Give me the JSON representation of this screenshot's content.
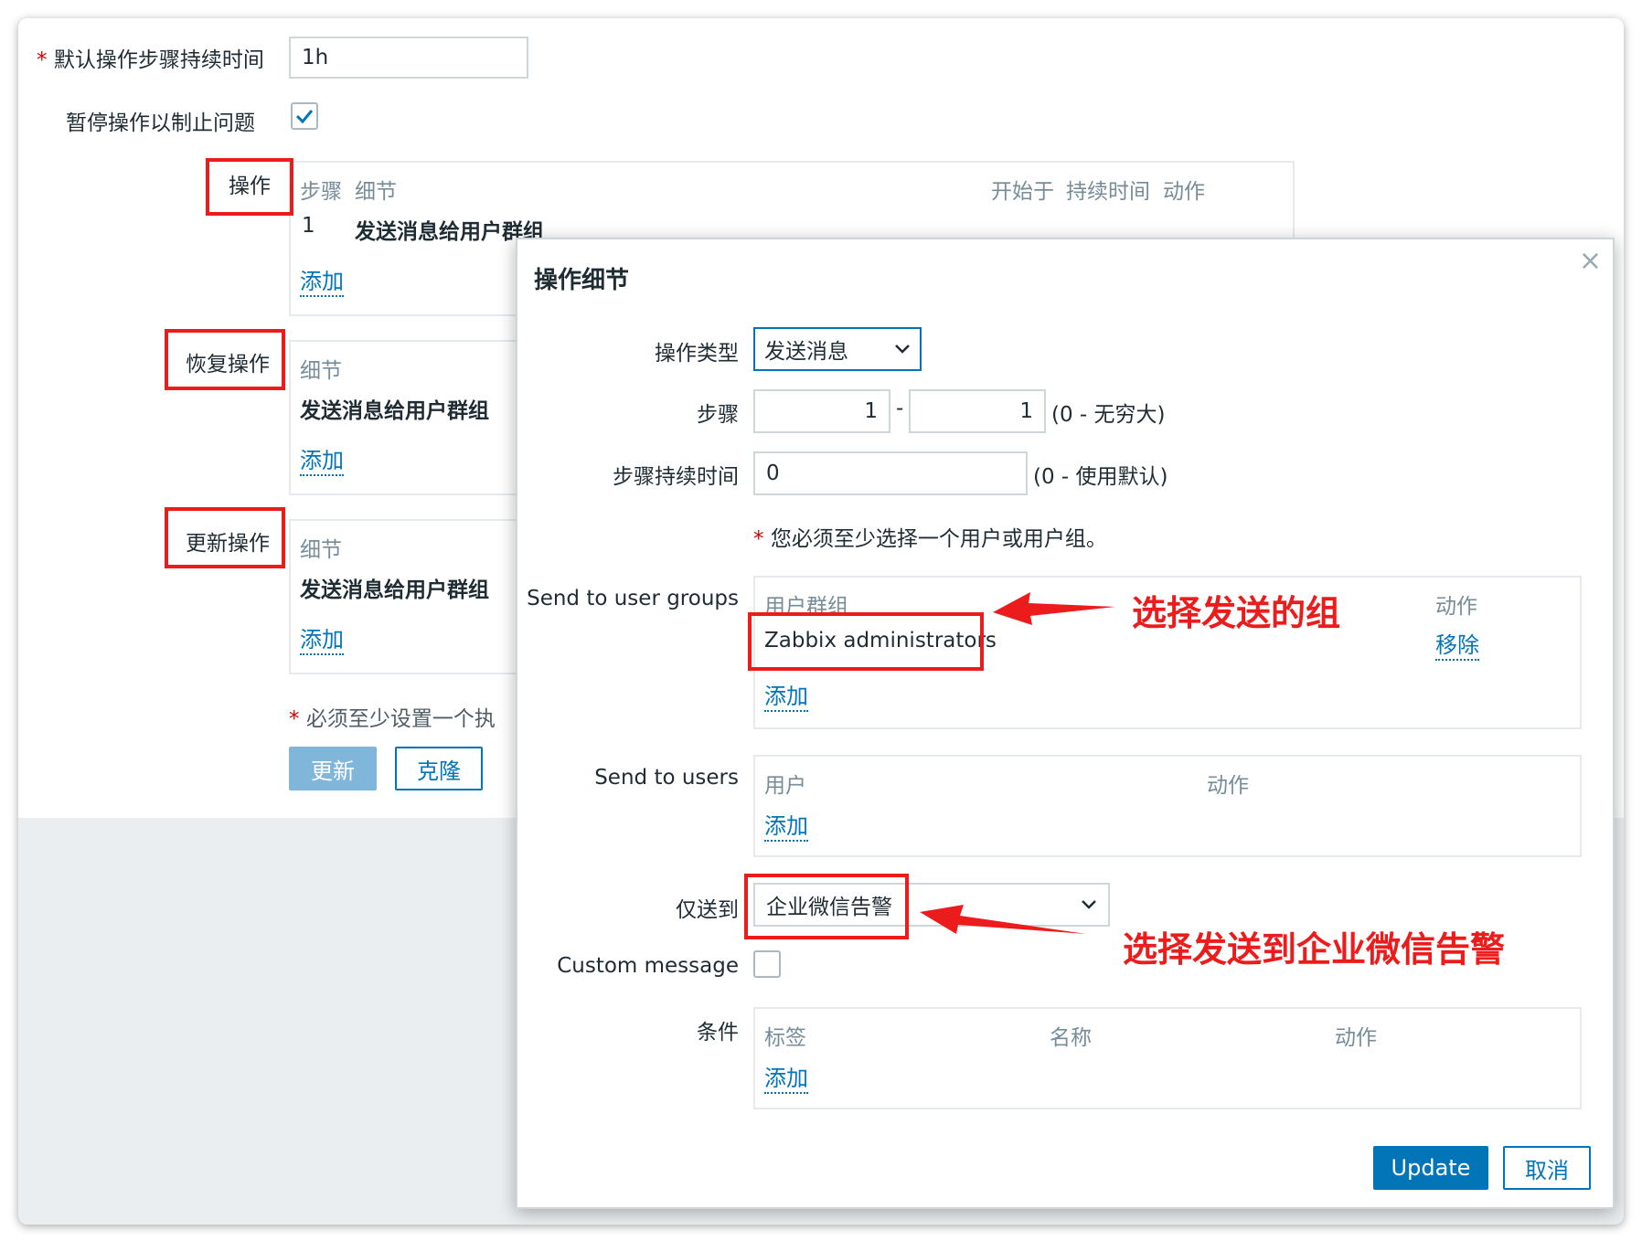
{
  "form": {
    "default_duration_label": "默认操作步骤持续时间",
    "default_duration_value": "1h",
    "pause_label": "暂停操作以制止问题",
    "operations": {
      "label": "操作",
      "col_steps": "步骤",
      "col_details": "细节",
      "col_start": "开始于",
      "col_duration": "持续时间",
      "col_action": "动作",
      "row_step": "1",
      "row_detail": "发送消息给用户群组",
      "add": "添加"
    },
    "recovery": {
      "label": "恢复操作",
      "col_details": "细节",
      "row_detail": "发送消息给用户群组",
      "add": "添加"
    },
    "update_ops": {
      "label": "更新操作",
      "col_details": "细节",
      "row_detail": "发送消息给用户群组",
      "add": "添加"
    },
    "required_note": "必须至少设置一个执",
    "update_button": "更新",
    "clone_button": "克隆"
  },
  "modal": {
    "title": "操作细节",
    "close_glyph": "×",
    "op_type_label": "操作类型",
    "op_type_value": "发送消息",
    "steps_label": "步骤",
    "step_from": "1",
    "step_sep": "-",
    "step_to": "1",
    "steps_hint": "(0 - 无穷大)",
    "step_duration_label": "步骤持续时间",
    "step_duration_value": "0",
    "step_duration_hint": "(0 - 使用默认)",
    "required_msg": "您必须至少选择一个用户或用户组。",
    "groups_label": "Send to user groups",
    "groups_col_group": "用户群组",
    "groups_col_action": "动作",
    "group_name": "Zabbix administrators",
    "group_remove": "移除",
    "groups_add": "添加",
    "users_label": "Send to users",
    "users_col_user": "用户",
    "users_col_action": "动作",
    "users_add": "添加",
    "send_only_label": "仅送到",
    "send_only_value": "企业微信告警",
    "custom_msg_label": "Custom message",
    "cond_label": "条件",
    "cond_col_tag": "标签",
    "cond_col_name": "名称",
    "cond_col_action": "动作",
    "cond_add": "添加",
    "update_button": "Update",
    "cancel_button": "取消"
  },
  "annotations": {
    "group_note": "选择发送的组",
    "media_note": "选择发送到企业微信告警"
  },
  "colors": {
    "accent": "#0275b8",
    "annotation_red": "#ec1c1c",
    "required": "#d40000"
  }
}
